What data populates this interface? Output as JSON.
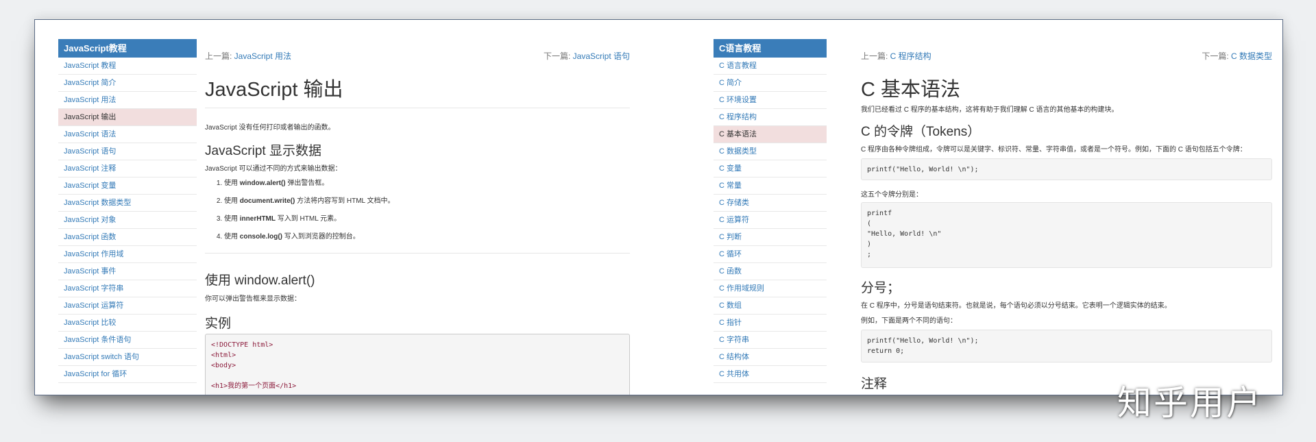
{
  "left": {
    "sidebar": {
      "title": "JavaScript教程",
      "items": [
        {
          "label": "JavaScript 教程"
        },
        {
          "label": "JavaScript 简介"
        },
        {
          "label": "JavaScript 用法"
        },
        {
          "label": "JavaScript 输出",
          "active": true
        },
        {
          "label": "JavaScript 语法"
        },
        {
          "label": "JavaScript 语句"
        },
        {
          "label": "JavaScript 注释"
        },
        {
          "label": "JavaScript 变量"
        },
        {
          "label": "JavaScript 数据类型"
        },
        {
          "label": "JavaScript 对象"
        },
        {
          "label": "JavaScript 函数"
        },
        {
          "label": "JavaScript 作用域"
        },
        {
          "label": "JavaScript 事件"
        },
        {
          "label": "JavaScript 字符串"
        },
        {
          "label": "JavaScript 运算符"
        },
        {
          "label": "JavaScript 比较"
        },
        {
          "label": "JavaScript 条件语句"
        },
        {
          "label": "JavaScript switch 语句"
        },
        {
          "label": "JavaScript for 循环"
        }
      ]
    },
    "nav": {
      "prev_prefix": "上一篇: ",
      "prev_link": "JavaScript 用法",
      "next_prefix": "下一篇: ",
      "next_link": "JavaScript 语句"
    },
    "title": "JavaScript 输出",
    "intro": "JavaScript 没有任何打印或者输出的函数。",
    "section1_title": "JavaScript 显示数据",
    "section1_text": "JavaScript 可以通过不同的方式来输出数据：",
    "steps": [
      {
        "pre": "使用 ",
        "code": "window.alert()",
        "post": " 弹出警告框。"
      },
      {
        "pre": "使用 ",
        "code": "document.write()",
        "post": " 方法将内容写到 HTML 文档中。"
      },
      {
        "pre": "使用 ",
        "code": "innerHTML",
        "post": " 写入到 HTML 元素。"
      },
      {
        "pre": "使用 ",
        "code": "console.log()",
        "post": " 写入到浏览器的控制台。"
      }
    ],
    "section2_title": "使用 window.alert()",
    "section2_text": "你可以弹出警告框来显示数据：",
    "example_title": "实例",
    "code_lines": [
      "<!DOCTYPE html>",
      "<html>",
      "<body>",
      "",
      "<h1>我的第一个页面</h1>"
    ]
  },
  "right": {
    "sidebar": {
      "title": "C语言教程",
      "items": [
        {
          "label": "C 语言教程"
        },
        {
          "label": "C 简介"
        },
        {
          "label": "C 环境设置"
        },
        {
          "label": "C 程序结构"
        },
        {
          "label": "C 基本语法",
          "active": true
        },
        {
          "label": "C 数据类型"
        },
        {
          "label": "C 变量"
        },
        {
          "label": "C 常量"
        },
        {
          "label": "C 存储类"
        },
        {
          "label": "C 运算符"
        },
        {
          "label": "C 判断"
        },
        {
          "label": "C 循环"
        },
        {
          "label": "C 函数"
        },
        {
          "label": "C 作用域规则"
        },
        {
          "label": "C 数组"
        },
        {
          "label": "C 指针"
        },
        {
          "label": "C 字符串"
        },
        {
          "label": "C 结构体"
        },
        {
          "label": "C 共用体"
        }
      ]
    },
    "nav": {
      "prev_prefix": "上一篇: ",
      "prev_link": "C 程序结构",
      "next_prefix": "下一篇: ",
      "next_link": "C 数据类型"
    },
    "title": "C 基本语法",
    "intro": "我们已经看过 C 程序的基本结构，这将有助于我们理解 C 语言的其他基本的构建块。",
    "tokens_title": "C 的令牌（Tokens）",
    "tokens_text": "C 程序由各种令牌组成，令牌可以是关键字、标识符、常量、字符串值，或者是一个符号。例如，下面的 C 语句包括五个令牌：",
    "code1": [
      "printf(\"Hello, World! \\n\");"
    ],
    "tokens_text2": "这五个令牌分别是：",
    "code2": [
      "printf",
      "(",
      "\"Hello, World! \\n\"",
      ")",
      ";"
    ],
    "semicolon_title": "分号；",
    "semicolon_text": "在 C 程序中，分号是语句结束符。也就是说，每个语句必须以分号结束。它表明一个逻辑实体的结束。",
    "semicolon_text2": "例如，下面是两个不同的语句：",
    "code3": [
      "printf(\"Hello, World! \\n\");",
      "return 0;"
    ],
    "comment_title": "注释"
  },
  "watermark": "知乎用户"
}
